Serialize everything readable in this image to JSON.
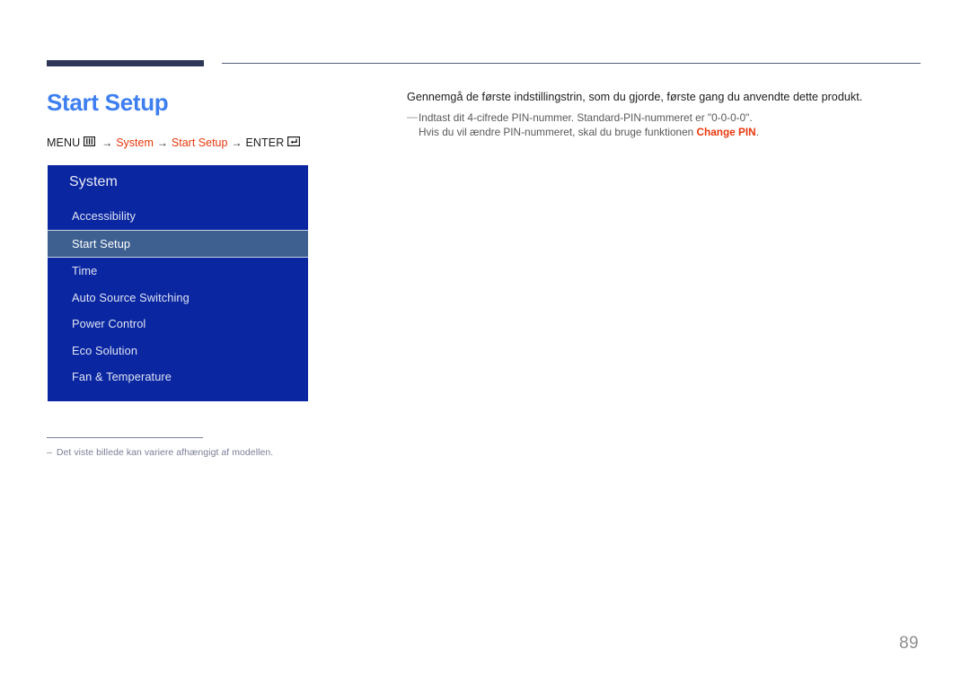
{
  "header": {
    "rule_color": "#2e3757"
  },
  "page": {
    "title": "Start Setup",
    "title_color": "#3d7ef0",
    "number": "89"
  },
  "breadcrumb": {
    "menu_label": "MENU",
    "menu_icon": "menu-grid-icon",
    "arrow": "→",
    "steps": [
      {
        "label": "System",
        "accent": true
      },
      {
        "label": "Start Setup",
        "accent": true
      }
    ],
    "enter_label": "ENTER",
    "enter_icon": "enter-return-icon",
    "accent_color": "#e8380d"
  },
  "osd": {
    "title": "System",
    "background_color": "#0a26a0",
    "highlight_color": "#3d6090",
    "items": [
      {
        "label": "Accessibility",
        "selected": false
      },
      {
        "label": "Start Setup",
        "selected": true
      },
      {
        "label": "Time",
        "selected": false
      },
      {
        "label": "Auto Source Switching",
        "selected": false
      },
      {
        "label": "Power Control",
        "selected": false
      },
      {
        "label": "Eco Solution",
        "selected": false
      },
      {
        "label": "Fan & Temperature",
        "selected": false
      }
    ]
  },
  "footnote": {
    "dash": "–",
    "text": "Det viste billede kan variere afhængigt af modellen."
  },
  "content": {
    "lead": "Gennemgå de første indstillingstrin, som du gjorde, første gang du anvendte dette produkt.",
    "note": {
      "dash": "—",
      "line1": "Indtast dit 4-cifrede PIN-nummer. Standard-PIN-nummeret er \"0-0-0-0\".",
      "line2_before": "Hvis du vil ændre PIN-nummeret, skal du bruge funktionen ",
      "line2_accent": "Change PIN",
      "line2_after": "."
    }
  }
}
